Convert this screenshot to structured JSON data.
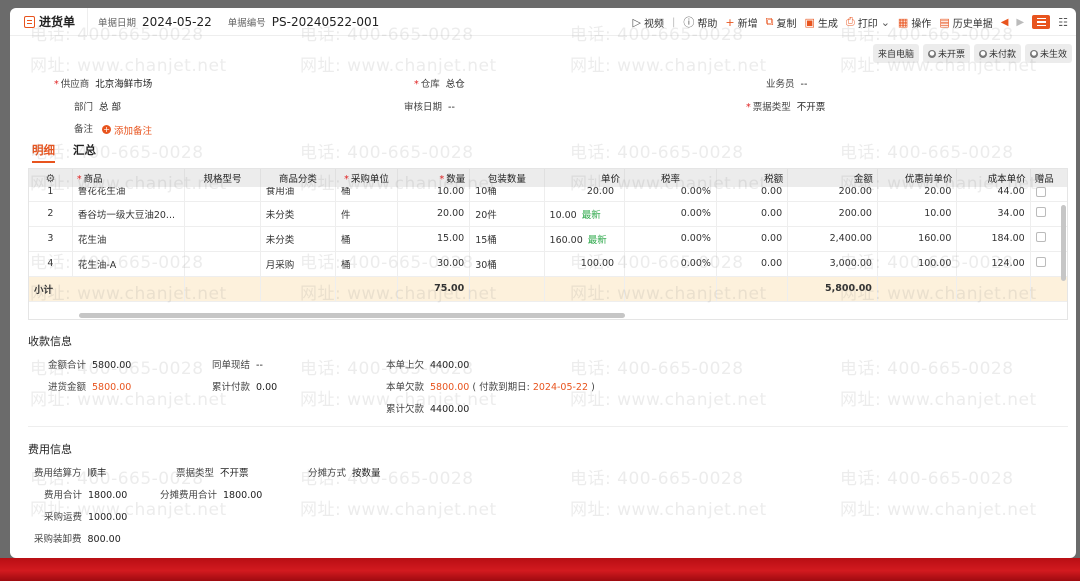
{
  "header": {
    "doc_title": "进货单",
    "date_label": "单据日期",
    "date_value": "2024-05-22",
    "no_label": "单据编号",
    "no_value": "PS-20240522-001"
  },
  "toolbar": {
    "video": "视频",
    "help": "帮助",
    "new": "新增",
    "copy": "复制",
    "generate": "生成",
    "print": "打印",
    "operate": "操作",
    "history": "历史单据"
  },
  "badges": [
    "来自电脑",
    "未开票",
    "未付款",
    "未生效"
  ],
  "form": {
    "supplier_label": "供应商",
    "supplier_value": "北京海鲜市场",
    "warehouse_label": "仓库",
    "warehouse_value": "总仓",
    "clerk_label": "业务员",
    "clerk_value": "--",
    "dept_label": "部门",
    "dept_value": "总 部",
    "audit_label": "审核日期",
    "audit_value": "--",
    "invoice_type_label": "票据类型",
    "invoice_type_value": "不开票",
    "note_label": "备注",
    "note_add": "添加备注"
  },
  "tabs": [
    "明细",
    "汇总"
  ],
  "table": {
    "headers": [
      "商品",
      "规格型号",
      "商品分类",
      "采购单位",
      "数量",
      "包装数量",
      "单价",
      "税率",
      "税额",
      "金额",
      "优惠前单价",
      "成本单价",
      "赠品"
    ],
    "rows": [
      {
        "idx": "1",
        "name": "鲁花花生油",
        "spec": "",
        "cat": "食用油",
        "unit": "桶",
        "qty": "10.00",
        "pack": "10桶",
        "price": "20.00",
        "latest": "",
        "tax": "0.00%",
        "taxamt": "0.00",
        "amt": "200.00",
        "pre": "20.00",
        "cost": "44.00"
      },
      {
        "idx": "2",
        "name": "香谷坊一级大豆油20...",
        "spec": "",
        "cat": "未分类",
        "unit": "件",
        "qty": "20.00",
        "pack": "20件",
        "price": "10.00",
        "latest": "最新",
        "tax": "0.00%",
        "taxamt": "0.00",
        "amt": "200.00",
        "pre": "10.00",
        "cost": "34.00"
      },
      {
        "idx": "3",
        "name": "花生油",
        "spec": "",
        "cat": "未分类",
        "unit": "桶",
        "qty": "15.00",
        "pack": "15桶",
        "price": "160.00",
        "latest": "最新",
        "tax": "0.00%",
        "taxamt": "0.00",
        "amt": "2,400.00",
        "pre": "160.00",
        "cost": "184.00"
      },
      {
        "idx": "4",
        "name": "花生油-A",
        "spec": "",
        "cat": "月采购",
        "unit": "桶",
        "qty": "30.00",
        "pack": "30桶",
        "price": "100.00",
        "latest": "",
        "tax": "0.00%",
        "taxamt": "0.00",
        "amt": "3,000.00",
        "pre": "100.00",
        "cost": "124.00"
      }
    ],
    "subtotal_label": "小计",
    "subtotal_qty": "75.00",
    "subtotal_amt": "5,800.00"
  },
  "payment": {
    "title": "收款信息",
    "total_label": "金额合计",
    "total_value": "5800.00",
    "purchase_label": "进货金额",
    "purchase_value": "5800.00",
    "same_label": "同单现结",
    "same_value": "--",
    "cum_paid_label": "累计付款",
    "cum_paid_value": "0.00",
    "prev_owe_label": "本单上欠",
    "prev_owe_value": "4400.00",
    "cur_owe_label": "本单欠款",
    "cur_owe_value": "5800.00",
    "due_prefix": "( 付款到期日:",
    "due_date": "2024-05-22",
    "due_suffix": ")",
    "cum_owe_label": "累计欠款",
    "cum_owe_value": "4400.00"
  },
  "fees": {
    "title": "费用信息",
    "settle_label": "费用结算方",
    "settle_value": "顺丰",
    "invoice_label": "票据类型",
    "invoice_value": "不开票",
    "alloc_method_label": "分摊方式",
    "alloc_method_value": "按数量",
    "fee_total_label": "费用合计",
    "fee_total_value": "1800.00",
    "alloc_total_label": "分摊费用合计",
    "alloc_total_value": "1800.00",
    "freight_label": "采购运费",
    "freight_value": "1000.00",
    "unload_label": "采购装卸费",
    "unload_value": "800.00"
  },
  "watermark": {
    "phone": "电话: 400-665-0028",
    "site": "网址: www.chanjet.net"
  }
}
